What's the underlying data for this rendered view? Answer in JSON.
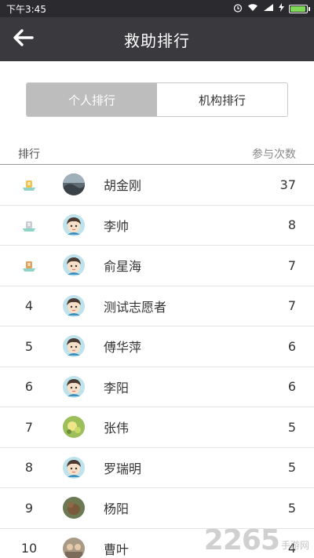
{
  "status_bar": {
    "time": "下午3:45",
    "battery_level": 0.95,
    "battery_color": "#7ed957"
  },
  "header": {
    "title": "救助排行"
  },
  "tabs": [
    {
      "label": "个人排行",
      "active": true
    },
    {
      "label": "机构排行",
      "active": false
    }
  ],
  "list_header": {
    "rank": "排行",
    "count": "参与次数"
  },
  "rows": [
    {
      "rank": "",
      "medal": "gold",
      "avatar": "photo-dark",
      "name": "胡金刚",
      "count": "37"
    },
    {
      "rank": "",
      "medal": "silver",
      "avatar": "cartoon-boy",
      "name": "李帅",
      "count": "8"
    },
    {
      "rank": "",
      "medal": "bronze",
      "avatar": "cartoon-boy",
      "name": "俞星海",
      "count": "7"
    },
    {
      "rank": "4",
      "medal": "",
      "avatar": "cartoon-boy",
      "name": "测试志愿者",
      "count": "7"
    },
    {
      "rank": "5",
      "medal": "",
      "avatar": "cartoon-boy",
      "name": "傅华萍",
      "count": "6"
    },
    {
      "rank": "6",
      "medal": "",
      "avatar": "cartoon-boy",
      "name": "李阳",
      "count": "6"
    },
    {
      "rank": "7",
      "medal": "",
      "avatar": "photo-flower",
      "name": "张伟",
      "count": "5"
    },
    {
      "rank": "8",
      "medal": "",
      "avatar": "cartoon-boy",
      "name": "罗瑞明",
      "count": "5"
    },
    {
      "rank": "9",
      "medal": "",
      "avatar": "photo-brown",
      "name": "杨阳",
      "count": "5"
    },
    {
      "rank": "10",
      "medal": "",
      "avatar": "photo-group",
      "name": "曹叶",
      "count": "4"
    }
  ],
  "watermark": {
    "number": "2265",
    "suffix": "手游网"
  }
}
